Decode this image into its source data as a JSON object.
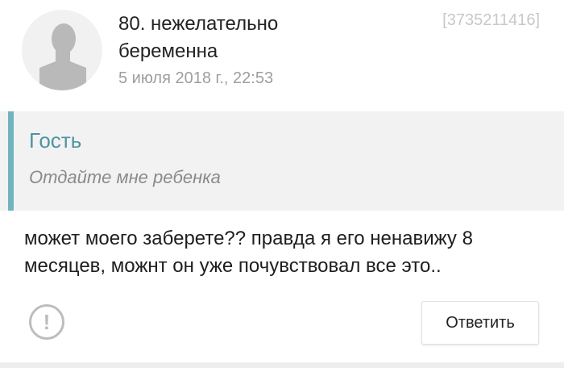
{
  "post": {
    "title": "80. нежелательно беременна",
    "date": "5 июля 2018 г., 22:53",
    "id": "[3735211416]"
  },
  "quote": {
    "author": "Гость",
    "text": "Отдайте мне ребенка"
  },
  "body": {
    "text": "может моего заберете?? правда я его ненавижу 8 месяцев, можнт он уже почувствовал все это.."
  },
  "actions": {
    "report_icon": "exclamation-circle-icon",
    "report_glyph": "!",
    "reply_label": "Ответить"
  },
  "colors": {
    "quote_accent": "#72b3c0",
    "quote_author": "#4e93a3",
    "quote_background": "#f2f2f2"
  }
}
